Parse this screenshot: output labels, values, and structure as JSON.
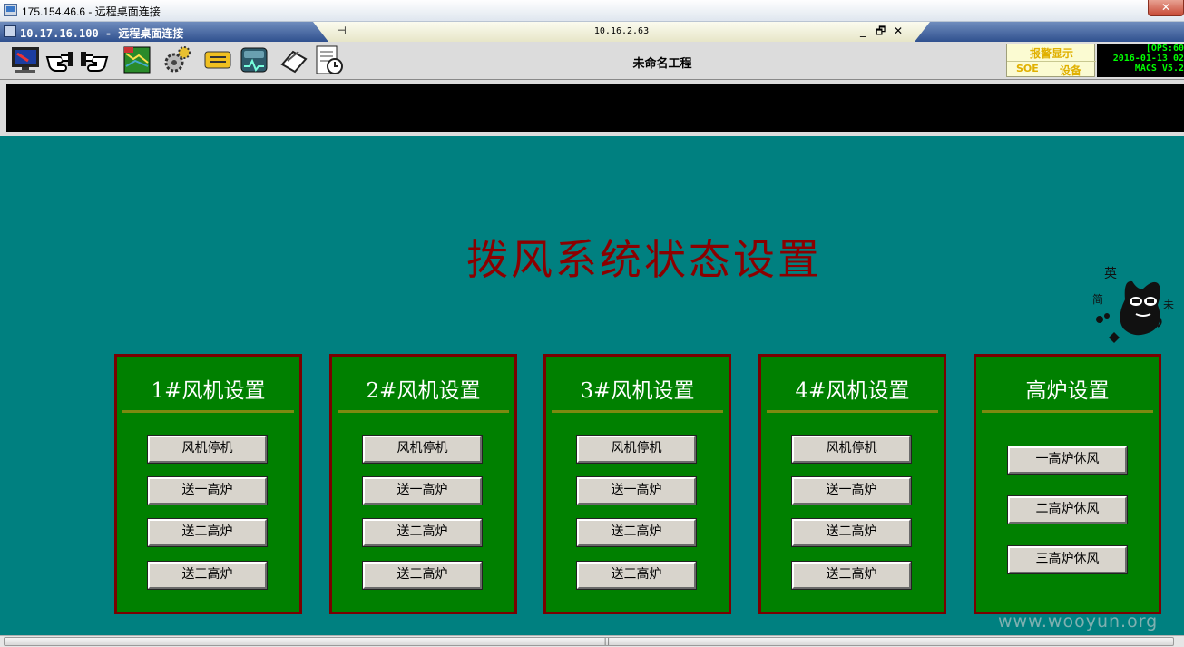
{
  "outer_window": {
    "title": "175.154.46.6 - 远程桌面连接"
  },
  "inner_window": {
    "title": "10.17.16.100 - 远程桌面连接"
  },
  "rdp_bar": {
    "pin": "⊣",
    "host": "10.16.2.63",
    "minimize": "_",
    "restore": "🗗",
    "close": "✕"
  },
  "toolbar": {
    "project_name": "未命名工程",
    "icons": [
      "monitor-icon",
      "hand-point-left-icon",
      "hand-point-right-icon",
      "map-icon",
      "gears-icon",
      "tag-icon",
      "trend-icon",
      "pen-pad-icon",
      "report-clock-icon"
    ]
  },
  "alarm": {
    "title": "报警显示",
    "left": "SOE",
    "right": "设备"
  },
  "status_info": {
    "line1": "[OPS:60",
    "line2": "2016-01-13 02",
    "line3": "MACS V5.2"
  },
  "main": {
    "title": "拨风系统状态设置",
    "panels": [
      {
        "title": "1#风机设置",
        "buttons": [
          "风机停机",
          "送一高炉",
          "送二高炉",
          "送三高炉"
        ]
      },
      {
        "title": "2#风机设置",
        "buttons": [
          "风机停机",
          "送一高炉",
          "送二高炉",
          "送三高炉"
        ]
      },
      {
        "title": "3#风机设置",
        "buttons": [
          "风机停机",
          "送一高炉",
          "送二高炉",
          "送三高炉"
        ]
      },
      {
        "title": "4#风机设置",
        "buttons": [
          "风机停机",
          "送一高炉",
          "送二高炉",
          "送三高炉"
        ]
      },
      {
        "title": "高炉设置",
        "buttons": [
          "一高炉休风",
          "二高炉休风",
          "三高炉休风"
        ]
      }
    ]
  },
  "sticker": {
    "c1": "英",
    "c2": "简",
    "c3": "未"
  },
  "watermark": "www.wooyun.org",
  "colors": {
    "background": "#008080",
    "panel": "#008000",
    "panel_border": "#7a0000",
    "title": "#8b0000"
  }
}
